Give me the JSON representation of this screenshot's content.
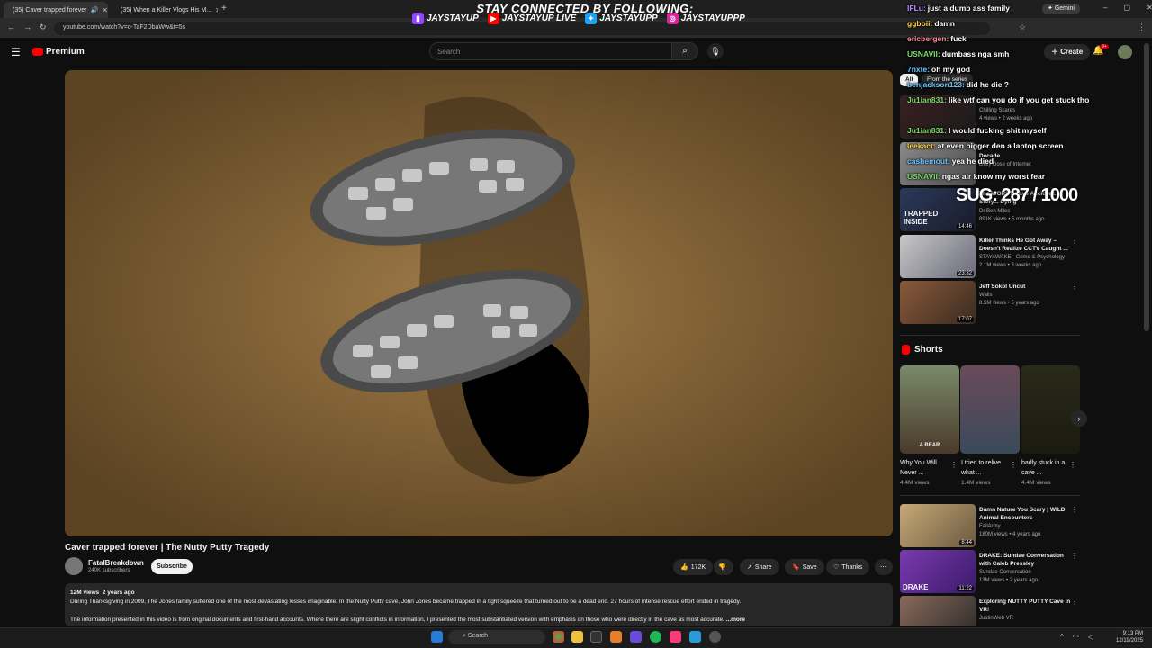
{
  "browser": {
    "tabs": [
      {
        "label": "(35) Caver trapped forever"
      },
      {
        "label": "(35) When a Killer Vlogs His M..."
      }
    ],
    "url": "youtube.com/watch?v=o-TaF2DbaWw&t=5s",
    "gemini_label": "Gemini"
  },
  "overlay": {
    "banner": "STAY CONNECTED BY FOLLOWING:",
    "socials": [
      "JAYSTAYUP",
      "JAYSTAYUP LIVE",
      "JAYSTAYUPP",
      "JAYSTAYUPPP"
    ],
    "sub_goal": "SUG: 287 / 1000"
  },
  "chat": [
    {
      "user": "IFLu:",
      "text": "just a dumb ass family",
      "color": "#b58cff"
    },
    {
      "user": "ggboii:",
      "text": "damn",
      "color": "#ffd34d"
    },
    {
      "user": "ericbergen:",
      "text": "fuck",
      "color": "#ff8aa0"
    },
    {
      "user": "USNAVII:",
      "text": "dumbass nga smh",
      "color": "#7bdc6b"
    },
    {
      "user": "7nxte:",
      "text": "oh my god",
      "color": "#6cc7ff"
    },
    {
      "user": "benjackson123:",
      "text": "did he die ?",
      "color": "#6cc7ff"
    },
    {
      "user": "Ju1ian831:",
      "text": "like wtf can you do if you get stuck tho",
      "color": "#7bdc6b"
    },
    {
      "user": "Ju1ian831:",
      "text": "I would fucking shit myself",
      "color": "#7bdc6b"
    },
    {
      "user": "leekact:",
      "text": "at even bigger den a laptop screen",
      "color": "#ffd34d"
    },
    {
      "user": "cashemout:",
      "text": "yea he died",
      "color": "#6cc7ff"
    },
    {
      "user": "USNAVII:",
      "text": "ngas air know my worst fear",
      "color": "#7bdc6b"
    }
  ],
  "youtube": {
    "logo": "Premium",
    "search_placeholder": "Search",
    "create_label": "Create",
    "notif_count": "9+",
    "chips": [
      "All",
      "From the series"
    ]
  },
  "video": {
    "title": "Caver trapped forever | The Nutty Putty Tragedy",
    "channel": "FatalBreakdown",
    "subscribers": "240K subscribers",
    "subscribe_label": "Subscribe",
    "likes": "172K",
    "share_label": "Share",
    "save_label": "Save",
    "thanks_label": "Thanks",
    "views": "12M views",
    "age": "2 years ago",
    "description_1": "During Thanksgiving in 2009, The Jones family suffered one of the most devastating losses imaginable. In the Nutty Putty cave, John Jones became trapped in a tight squeeze that turned out to be a dead end. 27 hours of intense rescue effort ended in tragedy.",
    "description_2": "The information presented in this video is from original documents and first-hand accounts. Where there are slight conflicts in information, I presented the most substantiated version with emphasis on those who were directly in the cave as most accurate.",
    "more_label": "...more"
  },
  "recommendations_top": [
    {
      "title": "",
      "channel": "Chilling Scares",
      "meta": "4 views • 2 weeks ago",
      "duration": ""
    },
    {
      "title": "Decade",
      "channel": "Daily Dose of Internet",
      "meta": "",
      "duration": ""
    },
    {
      "title": "The WORST Cave Accident... Story... Dying",
      "channel": "Dr Ben Miles",
      "meta": "891K views • 5 months ago",
      "duration": "14:46",
      "thumb_text": "TRAPPED INSIDE"
    },
    {
      "title": "Killer Thinks He Got Away – Doesn't Realize CCTV Caught ...",
      "channel": "STAYAWAKE - Crime & Psychology",
      "meta": "2.1M views • 3 weeks ago",
      "duration": "23:32"
    },
    {
      "title": "Jeff Sokol Uncut",
      "channel": "Walls",
      "meta": "8.5M views • 5 years ago",
      "duration": "17:07"
    }
  ],
  "shorts": {
    "heading": "Shorts",
    "items": [
      {
        "title": "Why You Will Never ...",
        "views": "4.4M views",
        "badge": "A BEAR"
      },
      {
        "title": "I tried to relive what ...",
        "views": "1.4M views",
        "badge": ""
      },
      {
        "title": "badly stuck in a cave ...",
        "views": "4.4M views",
        "badge": ""
      }
    ]
  },
  "recommendations_bottom": [
    {
      "title": "Damn Nature You Scary | WILD Animal Encounters",
      "channel": "FailArmy",
      "meta": "180M views • 4 years ago",
      "duration": "8:44"
    },
    {
      "title": "DRAKE: Sundae Conversation with Caleb Pressley",
      "channel": "Sundae Conversation",
      "meta": "13M views • 2 years ago",
      "duration": "11:22",
      "thumb_text": "DRAKE"
    },
    {
      "title": "Exploring NUTTY PUTTY Cave in VR!",
      "channel": "JustinWeb VR",
      "meta": "",
      "duration": ""
    }
  ],
  "taskbar": {
    "search_label": "Search",
    "time": "9:13 PM",
    "date": "12/19/2025"
  }
}
